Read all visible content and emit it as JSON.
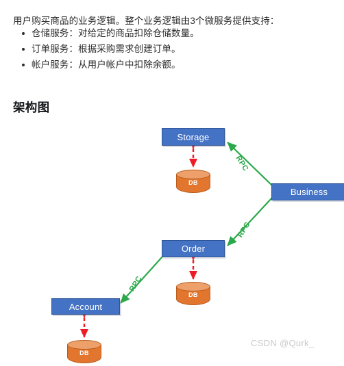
{
  "article": {
    "intro": "用户购买商品的业务逻辑。整个业务逻辑由3个微服务提供支持：",
    "bullets": [
      "仓储服务：对给定的商品扣除仓储数量。",
      "订单服务：根据采购需求创建订单。",
      "帐户服务：从用户帐户中扣除余额。"
    ],
    "heading": "架构图"
  },
  "diagram": {
    "nodes": [
      {
        "id": "storage",
        "label": "Storage"
      },
      {
        "id": "business",
        "label": "Business"
      },
      {
        "id": "order",
        "label": "Order"
      },
      {
        "id": "account",
        "label": "Account"
      }
    ],
    "databases": [
      {
        "for": "storage",
        "label": "DB"
      },
      {
        "for": "order",
        "label": "DB"
      },
      {
        "for": "account",
        "label": "DB"
      }
    ],
    "edges": [
      {
        "from": "business",
        "to": "storage",
        "label": "RPC",
        "style": "solid-green-arrow"
      },
      {
        "from": "business",
        "to": "order",
        "label": "RPC",
        "style": "solid-green-arrow"
      },
      {
        "from": "order",
        "to": "account",
        "label": "RPC",
        "style": "solid-green-arrow"
      },
      {
        "from": "storage",
        "to": "storage-db",
        "label": "",
        "style": "red-dashed-double-arrow"
      },
      {
        "from": "order",
        "to": "order-db",
        "label": "",
        "style": "red-dashed-double-arrow"
      },
      {
        "from": "account",
        "to": "account-db",
        "label": "",
        "style": "red-dashed-double-arrow"
      }
    ],
    "colors": {
      "node_fill": "#4472c4",
      "node_border": "#2e5496",
      "node_text": "#ffffff",
      "db_body": "#e2762e",
      "db_top": "#eda06a",
      "db_border": "#b85c1d",
      "rpc_line": "#2aa84a",
      "db_link": "#ee1c25"
    }
  },
  "watermark": "CSDN @Qurk_"
}
